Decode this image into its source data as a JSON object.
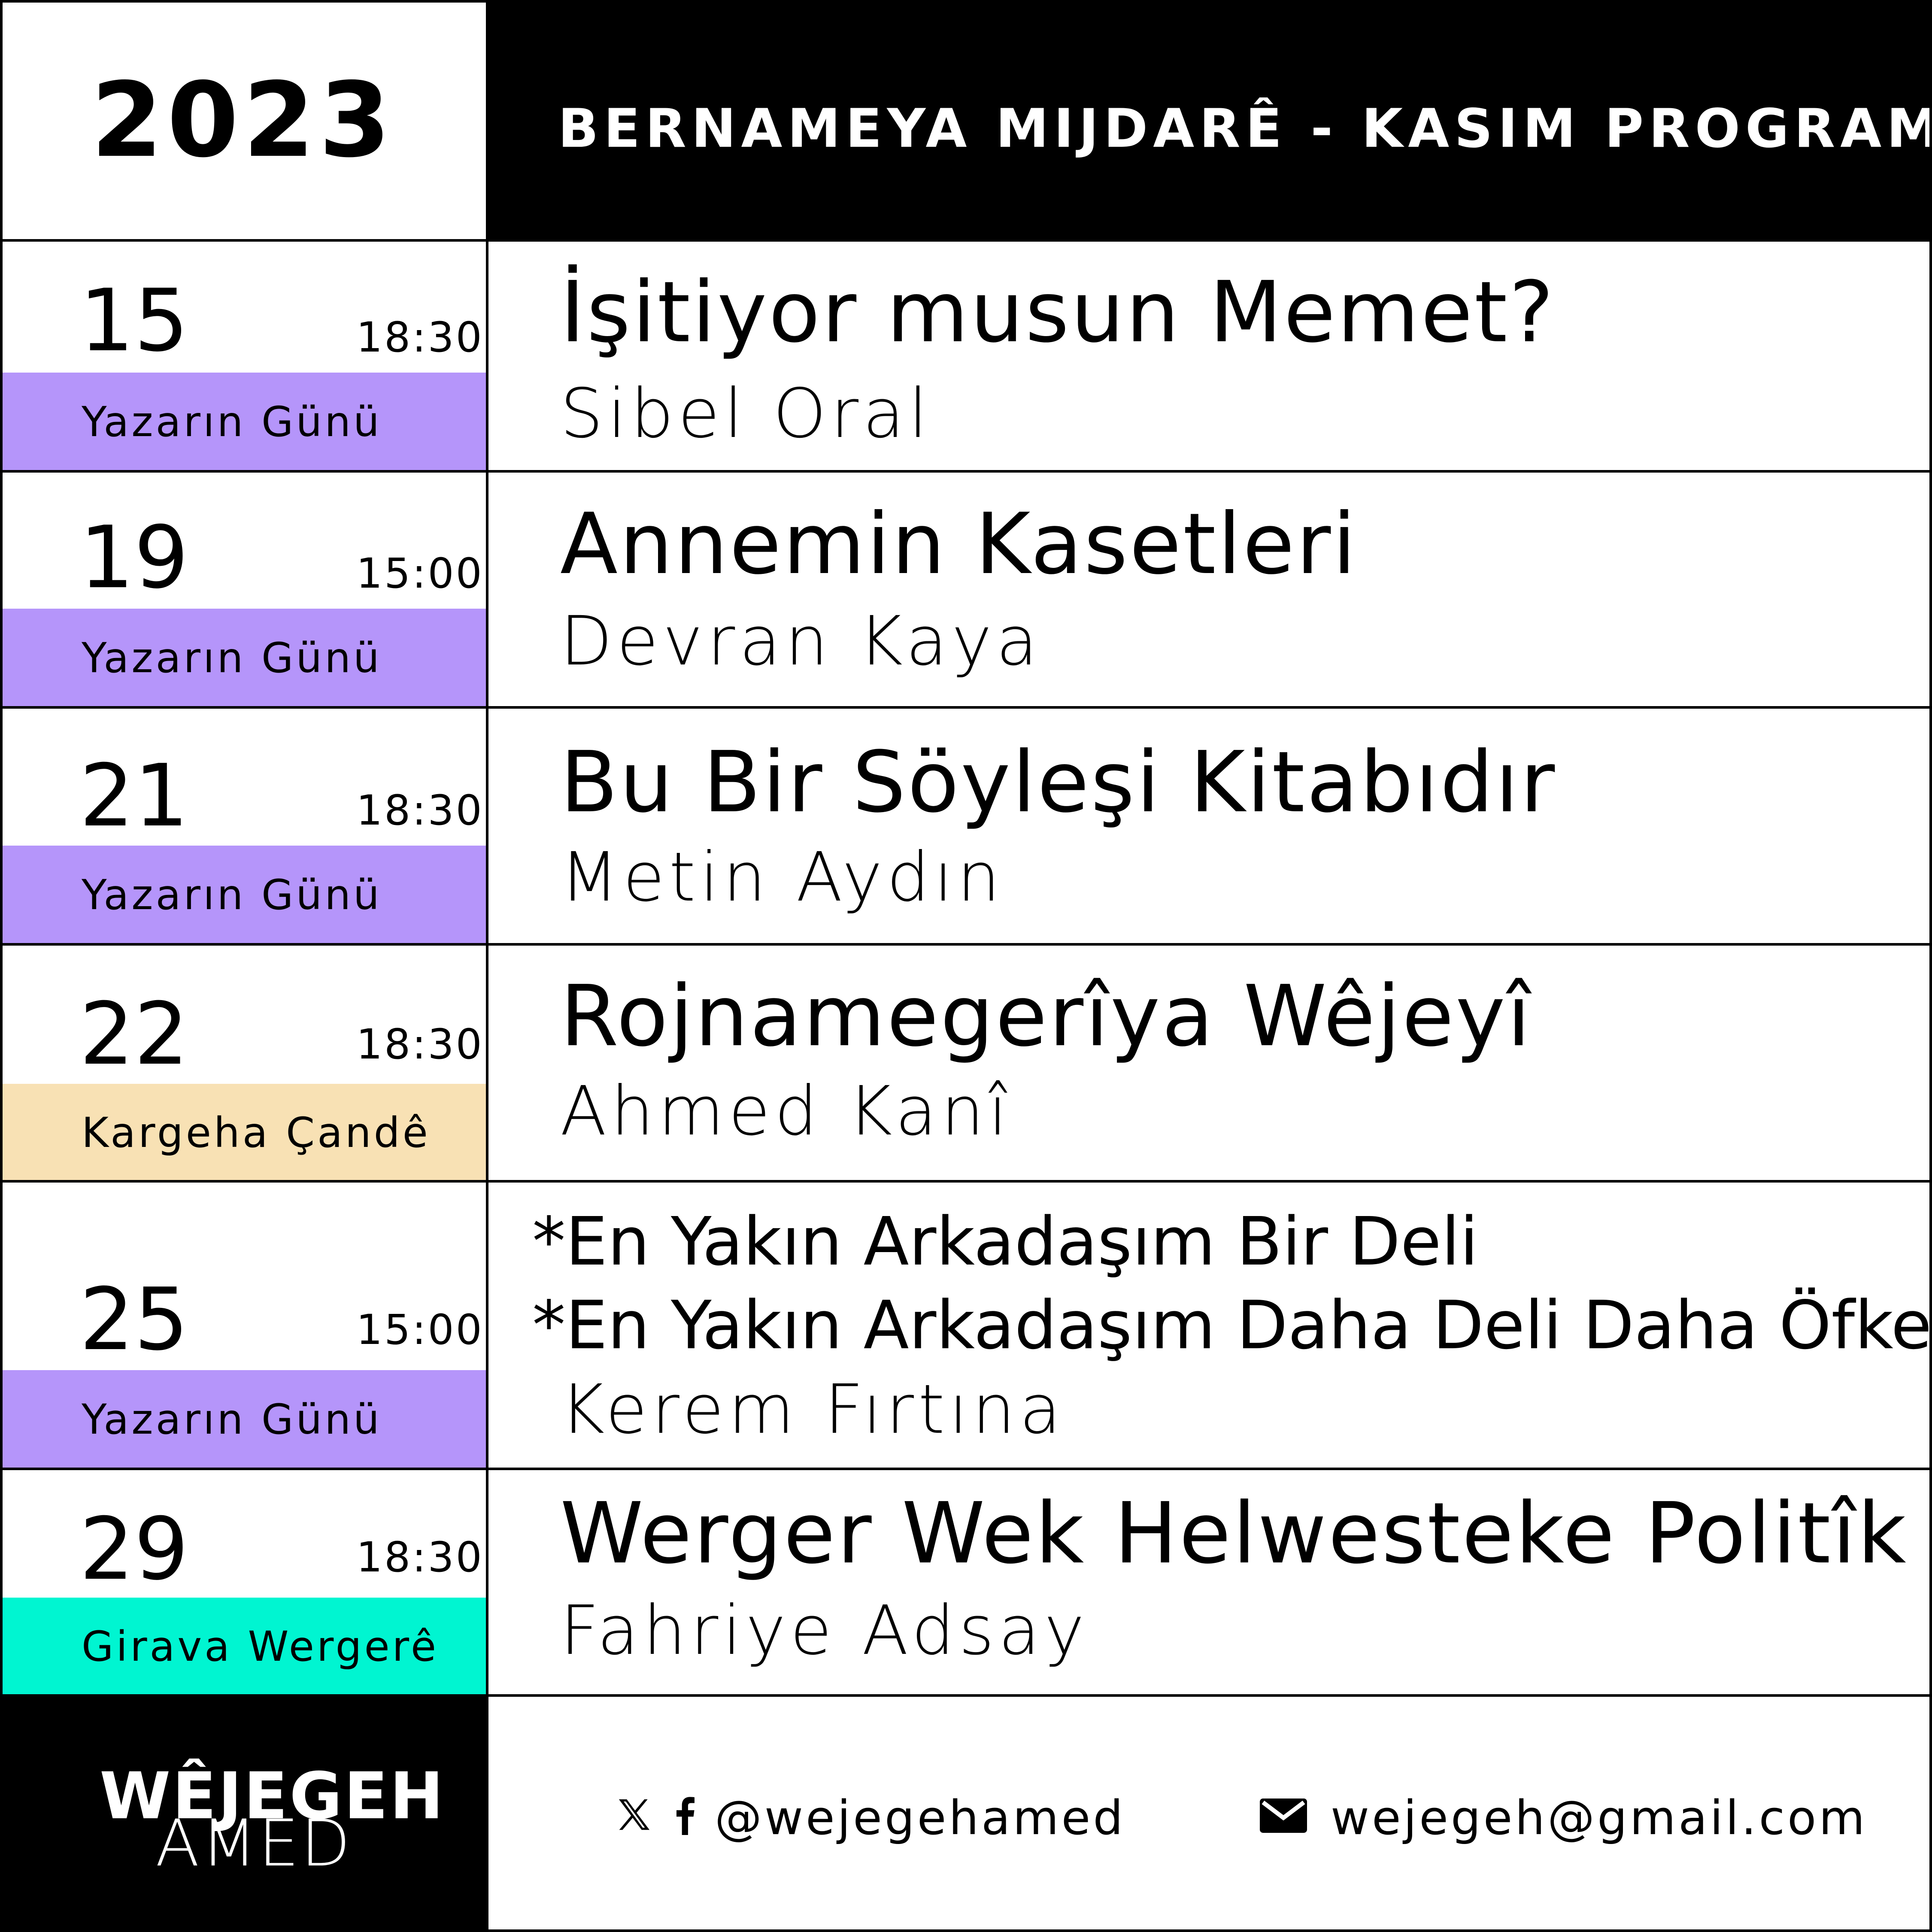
{
  "header": {
    "year": "2023",
    "title": "BERNAMEYA MIJDARÊ - KASIM PROGRAMI"
  },
  "events": [
    {
      "day": "15",
      "time": "18:30",
      "category": "Yazarın Günü",
      "title": "İşitiyor musun Memet?",
      "author": "Sibel Oral"
    },
    {
      "day": "19",
      "time": "15:00",
      "category": "Yazarın Günü",
      "title": "Annemin Kasetleri",
      "author": "Devran Kaya"
    },
    {
      "day": "21",
      "time": "18:30",
      "category": "Yazarın Günü",
      "title": "Bu Bir Söyleşi Kitabıdır",
      "author": "Metin Aydın"
    },
    {
      "day": "22",
      "time": "18:30",
      "category": "Kargeha Çandê",
      "title": "Rojnamegerîya Wêjeyî",
      "author": "Ahmed Kanî"
    },
    {
      "day": "25",
      "time": "15:00",
      "category": "Yazarın Günü",
      "titles": [
        "*En Yakın Arkadaşım Bir Deli",
        "*En Yakın Arkadaşım Daha Deli Daha Öfkeli"
      ],
      "author": "Kerem Fırtına"
    },
    {
      "day": "29",
      "time": "18:30",
      "category": "Girava Wergerê",
      "title": "Werger Wek Helwesteke Politîk",
      "author": "Fahriye Adsay"
    }
  ],
  "category_colors": {
    "Yazarın Günü": "#b595fa",
    "Kargeha Çandê": "#f8e1b4",
    "Girava Wergerê": "#00f5d1"
  },
  "footer": {
    "logo_line1": "WÊJEGEH",
    "logo_line2": "AMED",
    "social_icons": [
      "x-icon",
      "facebook-icon"
    ],
    "handle": "@wejegehamed",
    "email_icon": "envelope-icon",
    "email": "wejegeh@gmail.com"
  }
}
